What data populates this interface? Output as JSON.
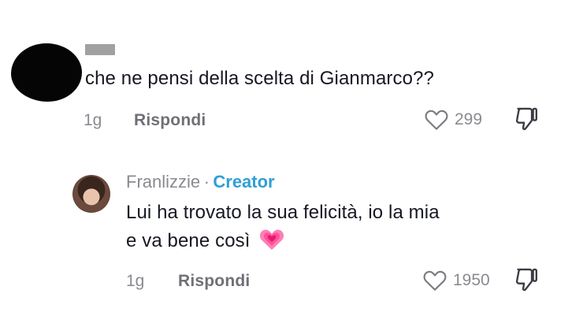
{
  "comment": {
    "text": "che ne pensi della scelta di Gianmarco??",
    "age": "1g",
    "reply_label": "Rispondi",
    "likes": "299",
    "icons": {
      "like": "heart-icon",
      "dislike": "thumbs-down-icon"
    }
  },
  "reply": {
    "username": "Franlizzie",
    "separator": "·",
    "badge": "Creator",
    "line1": "Lui ha trovato la sua felicità, io la mia",
    "line2": "e va bene così",
    "emoji": "💗",
    "age": "1g",
    "reply_label": "Rispondi",
    "likes": "1950",
    "icons": {
      "like": "heart-icon",
      "dislike": "thumbs-down-icon"
    }
  },
  "colors": {
    "text": "#161823",
    "muted": "#8a8b91",
    "creator": "#2f9fd6",
    "emoji_pink": "#ff4f9a"
  }
}
